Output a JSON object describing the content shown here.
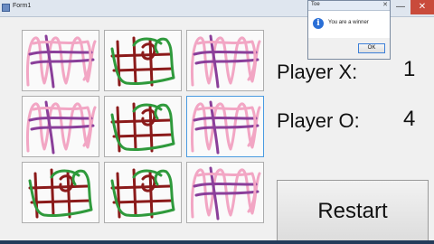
{
  "window": {
    "title": "Form1",
    "minimize_glyph": "—",
    "maximize_glyph": "□",
    "close_glyph": "✕"
  },
  "board": {
    "cells": [
      {
        "mark": "O"
      },
      {
        "mark": "X"
      },
      {
        "mark": "O"
      },
      {
        "mark": "O"
      },
      {
        "mark": "X"
      },
      {
        "mark": "O"
      },
      {
        "mark": "X"
      },
      {
        "mark": "X"
      },
      {
        "mark": "O"
      }
    ],
    "focused_cell_index": 5
  },
  "scores": {
    "x_label": "Player X:",
    "x_value": "1",
    "o_label": "Player O:",
    "o_value": "4"
  },
  "restart_label": "Restart",
  "dialog": {
    "title": "Toe",
    "message": "You are a winner",
    "ok_label": "OK",
    "close_glyph": "✕",
    "icon": "info-icon",
    "icon_glyph": "i"
  },
  "colors": {
    "x_dark": "#8b1a1a",
    "x_green": "#2f9a3c",
    "o_pink": "#f2a6c4",
    "o_purple": "#8a3f9a"
  }
}
